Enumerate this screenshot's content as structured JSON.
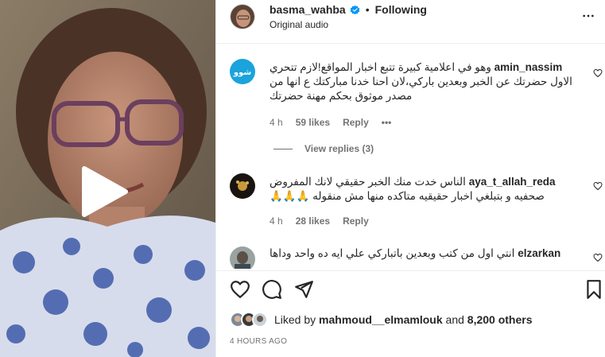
{
  "header": {
    "username": "basma_wahba",
    "separator": "•",
    "follow_status": "Following",
    "subtitle": "Original audio"
  },
  "comments": [
    {
      "username": "amin_nassim",
      "avatar_text": "شوو",
      "text": "وهو في اعلامية كبيرة تتبع اخبار المواقع!لازم تتحري الاول حضرتك عن الخبر وبعدين باركي،لان احنا خدنا مباركتك ع انها من مصدر موثوق بحكم مهنة حضرتك",
      "time": "4 h",
      "likes": "59 likes",
      "reply": "Reply",
      "more": "•••",
      "view_replies": "View replies (3)"
    },
    {
      "username": "aya_t_allah_reda",
      "text": "الناس خدت منك الخبر حقيقي لانك المفروض صحفيه و بتبلغي اخبار حقيقيه متاكده منها مش منقوله 🙏🙏🙏",
      "time": "4 h",
      "likes": "28 likes",
      "reply": "Reply"
    },
    {
      "username": "elzarkan",
      "text": "انتي اول من كتب وبعدين باتباركي علي ايه ده واحد وداها"
    }
  ],
  "likes": {
    "prefix": "Liked by",
    "user": "mahmoud__elmamlouk",
    "and": "and",
    "others": "8,200 others"
  },
  "post_time": "4 HOURS AGO",
  "icons": {
    "verified": "verified-badge-icon",
    "more": "more-options-icon",
    "play": "play-icon",
    "like": "heart-icon",
    "comment": "comment-icon",
    "share": "share-icon",
    "save": "bookmark-icon"
  },
  "colors": {
    "verified": "#0095f6",
    "text": "#262626",
    "secondary": "#737373",
    "border": "#efefef"
  }
}
